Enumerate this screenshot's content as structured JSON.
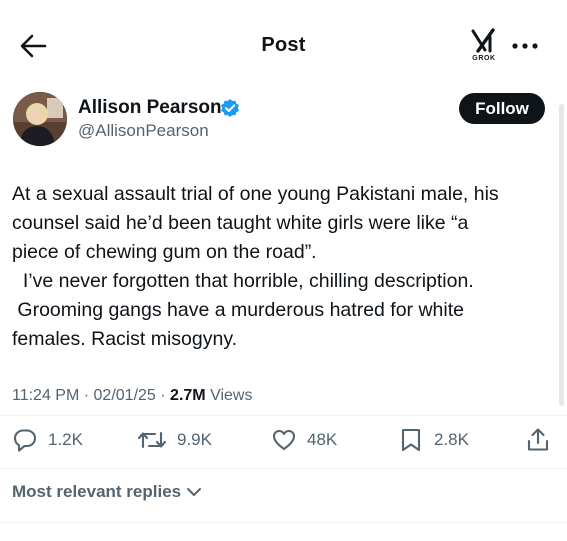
{
  "header": {
    "title": "Post",
    "grok_label": "GROK"
  },
  "author": {
    "name": "Allison Pearson",
    "handle": "@AllisonPearson",
    "verified": true,
    "follow_label": "Follow"
  },
  "post": {
    "lines": [
      "At a sexual assault trial of one young Pakistani male, his",
      "counsel said he’d been taught white girls were like “a",
      "piece of chewing gum on the road”.",
      "  I’ve never forgotten that horrible, chilling description.",
      " Grooming gangs have a murderous hatred for white",
      "females. Racist misogyny."
    ],
    "time": "11:24 PM",
    "date": "02/01/25",
    "views_count": "2.7M",
    "views_label": "Views"
  },
  "actions": {
    "replies": "1.2K",
    "reposts": "9.9K",
    "likes": "48K",
    "bookmarks": "2.8K"
  },
  "replies_sort": {
    "label": "Most relevant replies"
  },
  "colors": {
    "text": "#0f1419",
    "secondary": "#536471",
    "verified": "#1d9bf0",
    "follow_bg": "#0f1419",
    "divider": "#eff3f4"
  },
  "icons": {
    "back": "arrow-left-icon",
    "grok": "grok-logo-icon",
    "more": "more-dots-icon",
    "verified": "verified-badge-icon",
    "reply": "reply-bubble-icon",
    "repost": "repost-arrows-icon",
    "like": "heart-icon",
    "bookmark": "bookmark-icon",
    "share": "share-icon",
    "chevron": "chevron-down-icon"
  }
}
